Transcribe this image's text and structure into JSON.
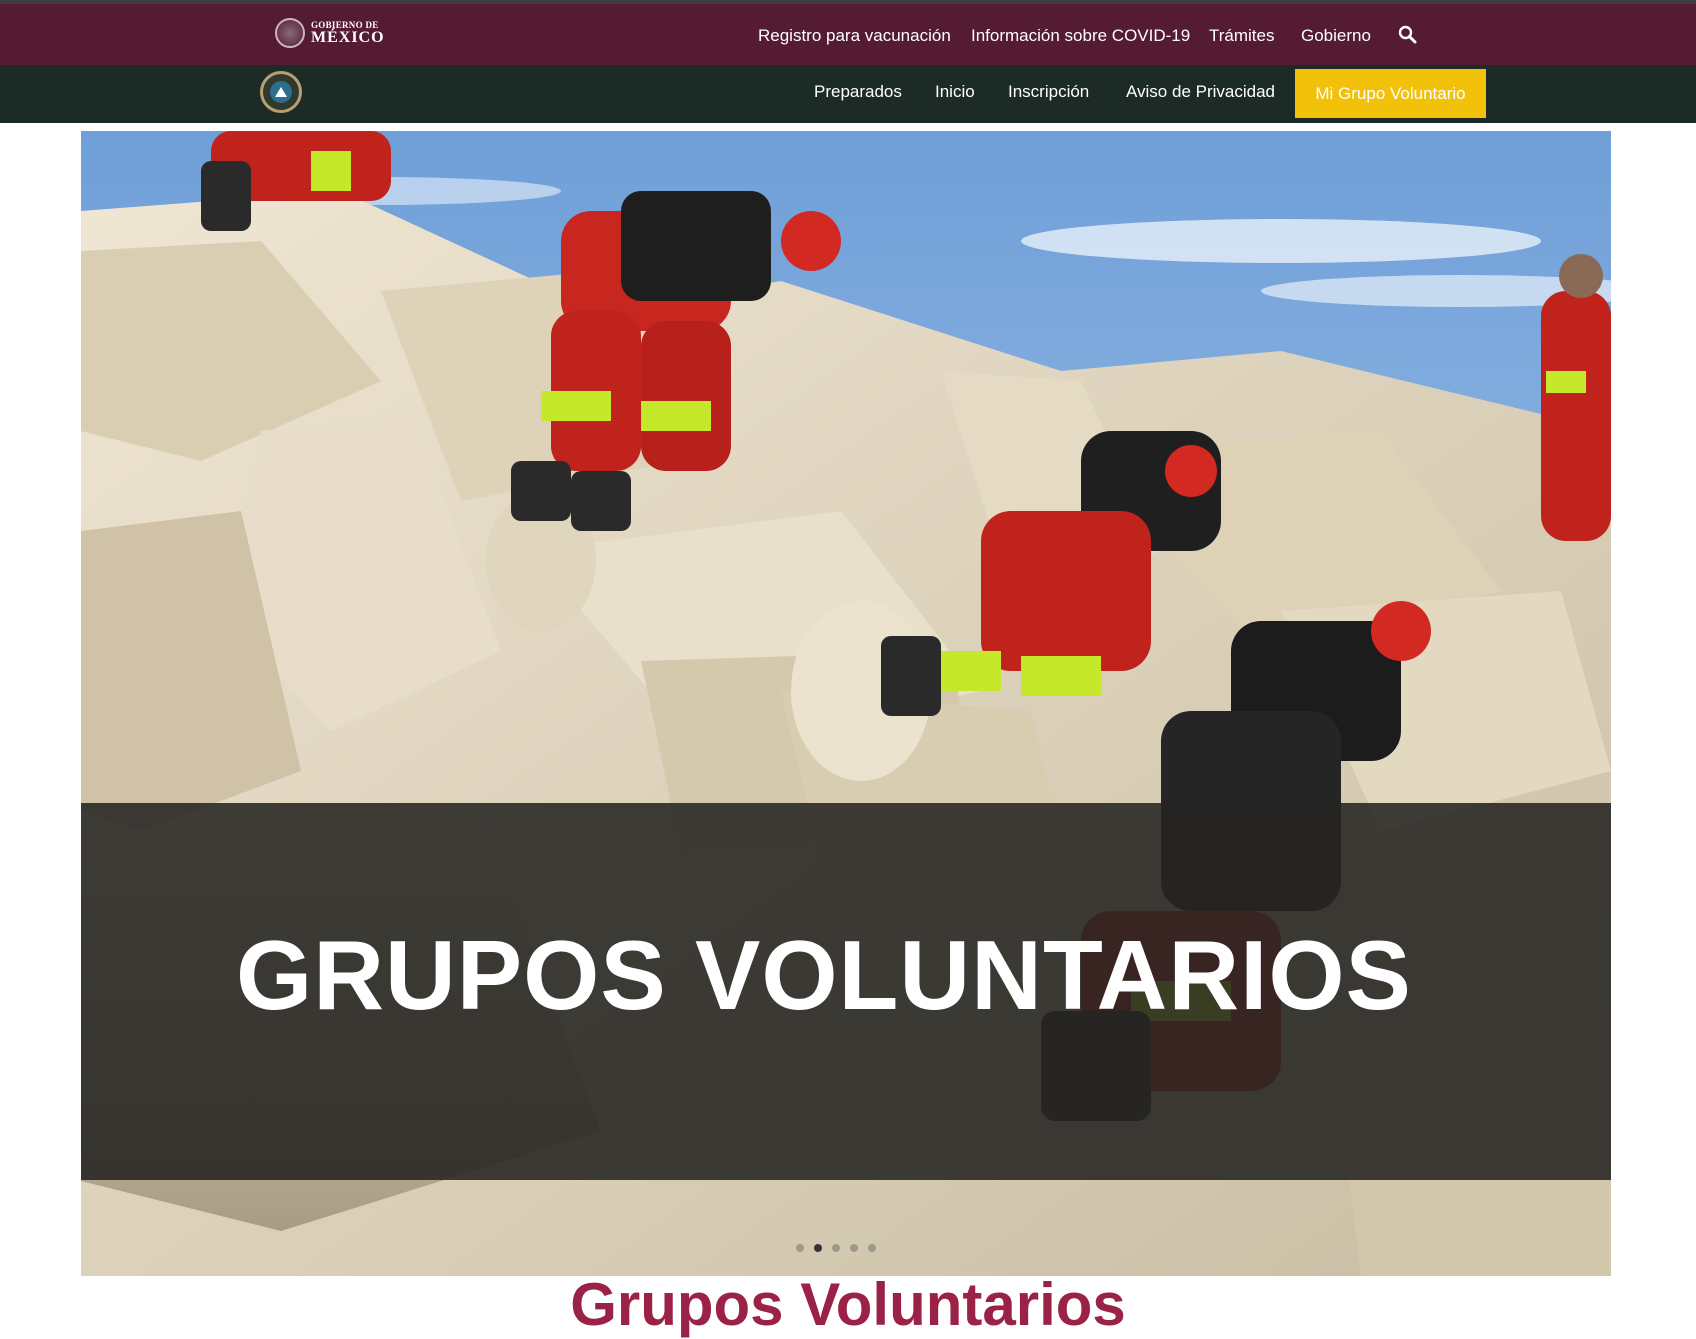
{
  "gov_header": {
    "logo_small": "GOBIERNO DE",
    "logo_big": "MÉXICO",
    "links": [
      "Registro para vacunación",
      "Información sobre COVID-19",
      "Trámites",
      "Gobierno"
    ],
    "search_icon": "search-icon",
    "bg_color": "#541b33"
  },
  "site_nav": {
    "logo_icon": "proteccion-civil-logo",
    "links": [
      "Preparados",
      "Inicio",
      "Inscripción",
      "Aviso de Privacidad"
    ],
    "cta_label": "Mi Grupo Voluntario",
    "bg_color": "#1d2b26",
    "cta_color": "#f2c20b"
  },
  "hero": {
    "title": "GRUPOS VOLUNTARIOS",
    "slide_count": 5,
    "active_slide": 1
  },
  "section": {
    "title": "Grupos Voluntarios",
    "color": "#9b2247"
  }
}
